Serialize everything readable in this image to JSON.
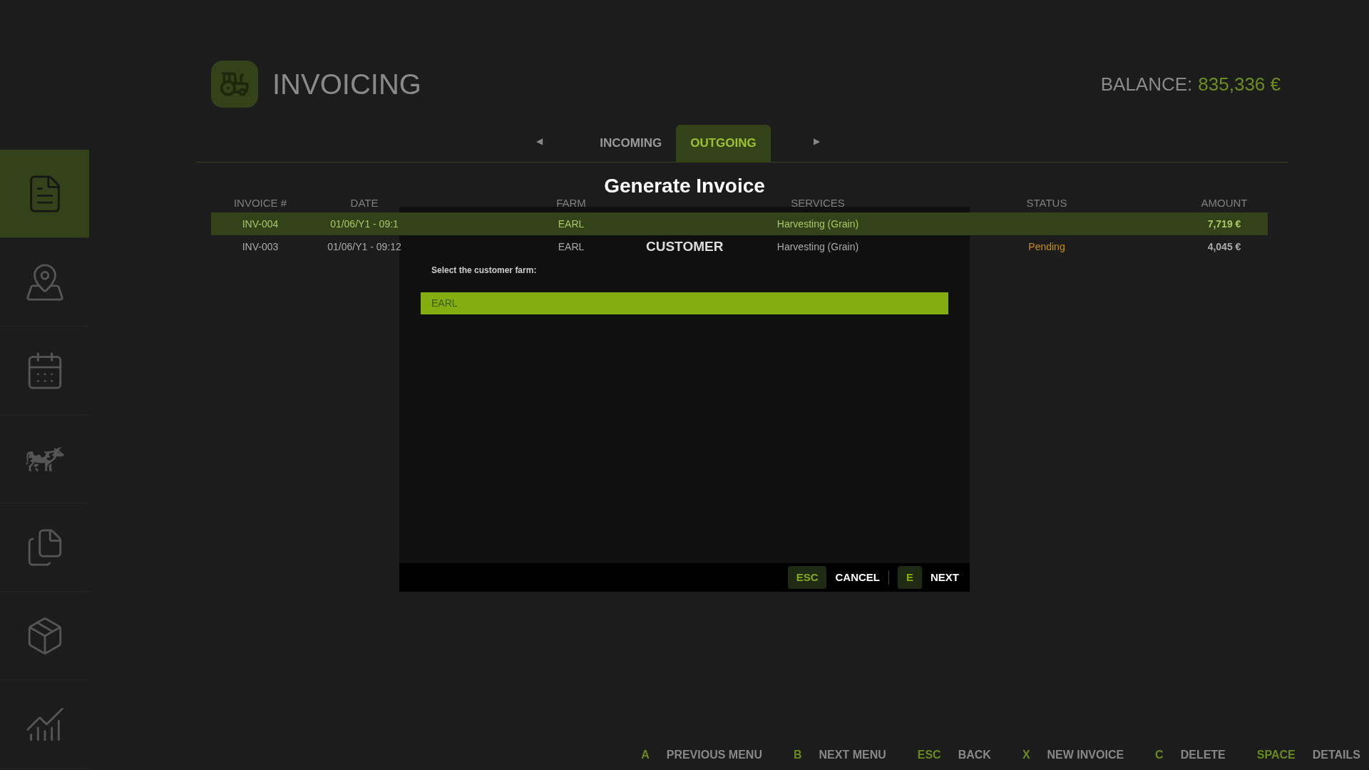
{
  "header": {
    "title": "INVOICING",
    "balance_label": "BALANCE:",
    "balance_value": "835,336 €"
  },
  "sidebar": {
    "items": [
      {
        "selected": true
      },
      {
        "selected": false
      },
      {
        "selected": false
      },
      {
        "selected": false
      },
      {
        "selected": false
      },
      {
        "selected": false
      },
      {
        "selected": false
      }
    ]
  },
  "tabs": {
    "prev": "◀",
    "next": "▶",
    "items": [
      {
        "label": "INCOMING",
        "selected": false
      },
      {
        "label": "OUTGOING",
        "selected": true
      }
    ]
  },
  "table": {
    "columns": [
      "INVOICE #",
      "DATE",
      "FARM",
      "SERVICES",
      "STATUS",
      "AMOUNT"
    ],
    "rows": [
      {
        "selected": true,
        "cells": [
          "INV-004",
          "01/06/Y1 - 09:1",
          "EARL",
          "Harvesting (Grain)",
          "",
          "7,719 €"
        ]
      },
      {
        "selected": false,
        "cells": [
          "INV-003",
          "01/06/Y1 - 09:12",
          "EARL",
          "Harvesting (Grain)",
          "Pending",
          "4,045 €"
        ]
      }
    ]
  },
  "dialog": {
    "title": "Generate Invoice",
    "section": "CUSTOMER",
    "prompt": "Select the customer farm:",
    "options": [
      {
        "label": "EARL",
        "selected": true
      }
    ],
    "actions": [
      {
        "key": "ESC",
        "label": "CANCEL"
      },
      {
        "key": "E",
        "label": "NEXT"
      }
    ]
  },
  "hints": [
    {
      "key": "A",
      "label": "PREVIOUS MENU"
    },
    {
      "key": "B",
      "label": "NEXT MENU"
    },
    {
      "key": "ESC",
      "label": "BACK"
    },
    {
      "key": "X",
      "label": "NEW INVOICE"
    },
    {
      "key": "C",
      "label": "DELETE"
    },
    {
      "key": "SPACE",
      "label": "DETAILS"
    }
  ]
}
